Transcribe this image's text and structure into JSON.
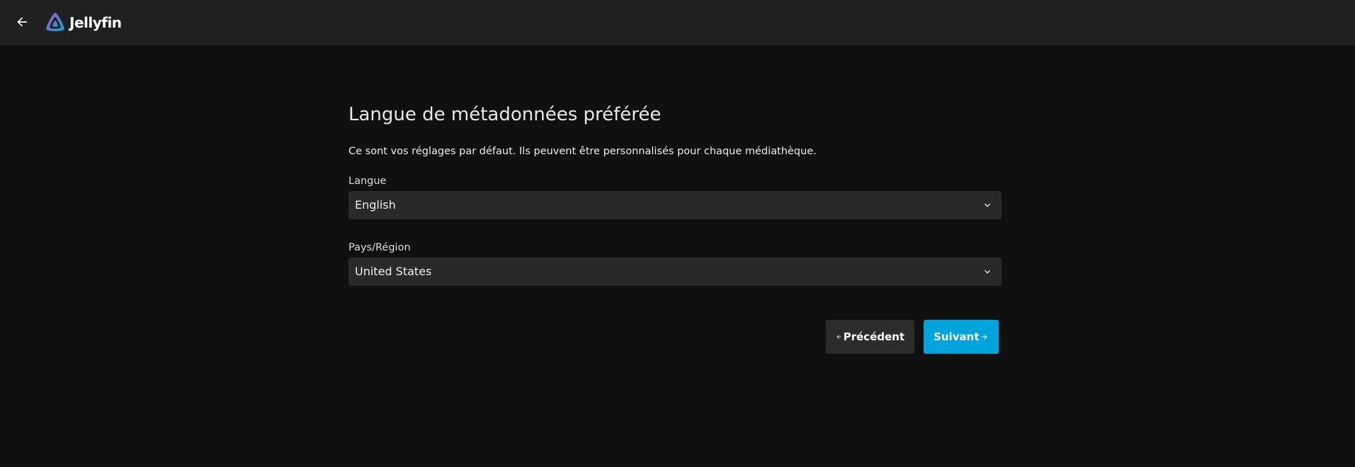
{
  "header": {
    "app_name": "Jellyfin",
    "back_icon": "arrow-left-icon",
    "logo_icon": "jellyfin-logo-icon"
  },
  "page": {
    "title": "Langue de métadonnées préférée",
    "description": "Ce sont vos réglages par défaut. Ils peuvent être personnalisés pour chaque médiathèque."
  },
  "form": {
    "language": {
      "label": "Langue",
      "value": "English"
    },
    "country": {
      "label": "Pays/Région",
      "value": "United States"
    }
  },
  "actions": {
    "previous_label": "Précédent",
    "next_label": "Suivant"
  },
  "colors": {
    "background": "#101010",
    "header": "#202020",
    "select_bg": "#292929",
    "accent": "#00a4dc",
    "secondary_button": "#2c2c2c"
  }
}
